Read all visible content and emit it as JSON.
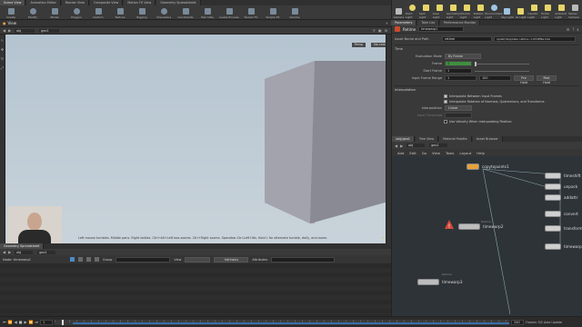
{
  "top_left_tabs": [
    "Scene View",
    "Animation Editor",
    "Render View",
    "Composite View",
    "Motion FX View",
    "Geometry Spreadsheet"
  ],
  "shelf_left": [
    "Create",
    "Modify",
    "Model",
    "Polygon",
    "Deform",
    "Texture",
    "Rigging",
    "Characters",
    "Constraints",
    "Hair Utils",
    "Guide Process",
    "Terrain FX",
    "Simple FX",
    "Volume"
  ],
  "shelf_right": [
    "Camera",
    "Point Light",
    "Spot Light",
    "Area Light",
    "Geometry Light",
    "Volume Light",
    "Distant Light",
    "Environment Light",
    "Sky Light",
    "GI Light",
    "Caustic Light",
    "Portal Light",
    "Ambient Light",
    "Stereo Camera",
    "VR Camera",
    "Switcher",
    "Gamepad Camera"
  ],
  "right_top_tabs": [
    "Parameters",
    "Take List",
    "Performance Monitor"
  ],
  "viewport": {
    "title": "View",
    "path_obj": "obj",
    "path_geo": "geo1",
    "persp_label": "Persp",
    "cam_label": "No cam",
    "hint": "Left mouse tumbles. Middle pans. Right dollies. Ctrl+Alt+Left box-zooms. Ctrl+Right zooms. Spacebar-Ctrl-Left tilts. Hold L for alternate tumble, dolly, and zoom."
  },
  "params": {
    "node_type": "Retime",
    "node_name": "timewarp1",
    "asset_label": "Asset Name and Path",
    "asset_value": "retime",
    "asset_path": "opdef:/Sop/labs::retime::1.0?OPfile.hda",
    "section_time": "Time",
    "eval_mode_label": "Evaluation Mode",
    "eval_mode_value": "By Frame",
    "frame_label": "Frame",
    "frame_value": "1",
    "start_frame_label": "Start Frame",
    "start_frame_value": "1",
    "input_range_label": "Input Frame Range",
    "input_range_start": "1",
    "input_range_end": "100",
    "pre_hold": "Pre Hold",
    "post_hold": "Post Hold",
    "section_interp": "Interpolation",
    "chk_interp": "Interpolate Between Input Frames",
    "chk_rotation": "Interpolate Rotation of Normals, Quaternions, and Transforms",
    "interp_label": "Interpolation",
    "interp_value": "Linear",
    "input_threshold": "Input Threshold",
    "chk_velocity": "Use Velocity When Interpolating Position"
  },
  "network": {
    "tabs": [
      "/obj/geo1",
      "Tree View",
      "Material Palette",
      "Asset Browser"
    ],
    "path_obj": "obj",
    "path_geo": "geo1",
    "menu": [
      "Add",
      "Edit",
      "Go",
      "View",
      "Tools",
      "Layout",
      "Help"
    ],
    "nodes": {
      "copytopoints": "copytopoints1",
      "timewarp1": "timewarp1",
      "timewarp2": "timewarp2",
      "timewarp3": "timewarp3",
      "timewarp3_type": "Retime",
      "timewarp2_type": "Retime",
      "r1": "timeshift",
      "r2": "unpack",
      "r3": "addattr",
      "r4": "convert",
      "r5": "transform",
      "r6": "timewarp"
    }
  },
  "spreadsheet": {
    "tab": "Geometry Spreadsheet",
    "path_obj": "obj",
    "path_geo": "geo1",
    "node_label": "Node: timewarp1",
    "group_label": "Group",
    "view_label": "View",
    "intrinsics_label": "Intrinsics",
    "attributes_label": "Attributes"
  },
  "timeline": {
    "frame": "1",
    "end_frame": "240",
    "status": "Frames: 5/5 Auto Update"
  }
}
